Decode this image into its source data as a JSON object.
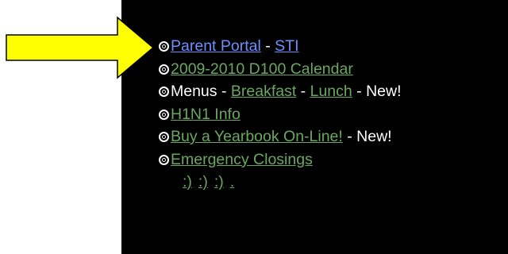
{
  "colors": {
    "panel_bg": "#000000",
    "page_bg": "#ffffff",
    "arrow_fill": "#ffff00",
    "arrow_stroke": "#000000",
    "link_blue": "#6e8fff",
    "link_green": "#6aa860",
    "text": "#ffffff"
  },
  "icons": {
    "arrow": "arrow-right-icon",
    "bullet": "target-circle-icon"
  },
  "links": {
    "parent_portal": "Parent Portal",
    "sep1": " - ",
    "sti": "STI",
    "calendar": "2009-2010 D100 Calendar",
    "menus": "Menus",
    "sep2": " - ",
    "breakfast": "Breakfast",
    "sep3": " - ",
    "lunch": "Lunch",
    "new1": " - New!",
    "h1n1": "H1N1 Info",
    "yearbook": "Buy a Yearbook On-Line!",
    "new2": " - New!",
    "closings": "Emergency Closings",
    "smile1": ":)",
    "smile2": ":)",
    "smile3": ":)",
    "dot": "."
  }
}
